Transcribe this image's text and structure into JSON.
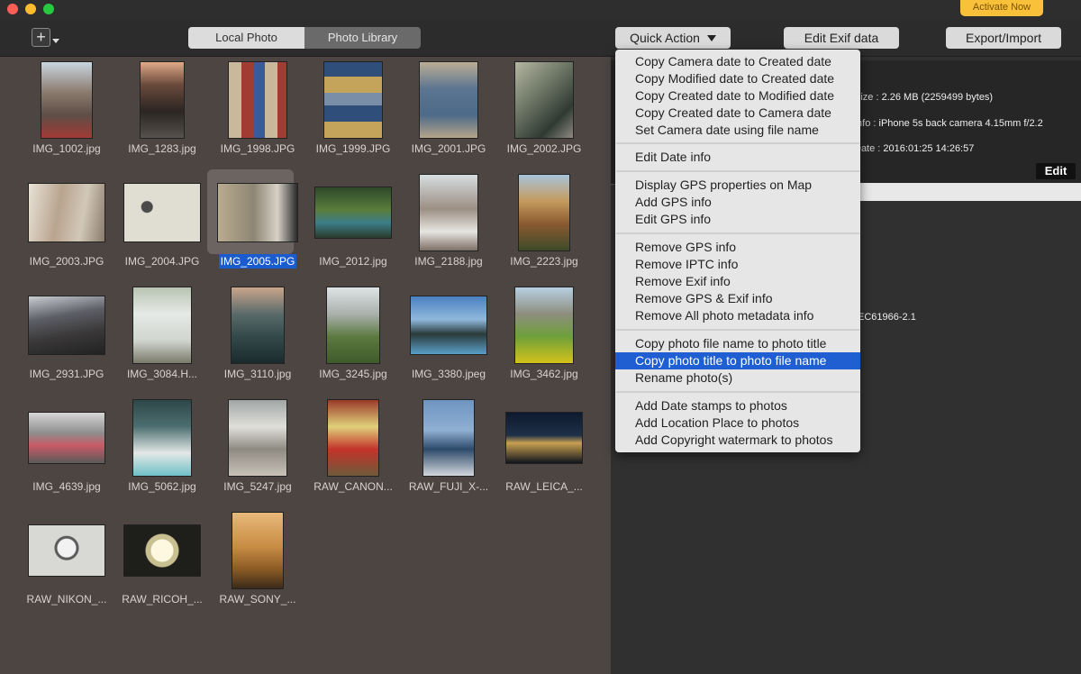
{
  "activate_label": "Activate Now",
  "toolbar": {
    "add_label": "+",
    "tabs": [
      "Local Photo",
      "Photo Library"
    ],
    "quick_action_label": "Quick Action",
    "edit_exif_label": "Edit Exif data",
    "export_label": "Export/Import"
  },
  "photos": [
    "IMG_1002.jpg",
    "IMG_1283.jpg",
    "IMG_1998.JPG",
    "IMG_1999.JPG",
    "IMG_2001.JPG",
    "IMG_2002.JPG",
    "IMG_2003.JPG",
    "IMG_2004.JPG",
    "IMG_2005.JPG",
    "IMG_2012.jpg",
    "IMG_2188.jpg",
    "IMG_2223.jpg",
    "IMG_2931.JPG",
    "IMG_3084.H...",
    "IMG_3110.jpg",
    "IMG_3245.jpg",
    "IMG_3380.jpeg",
    "IMG_3462.jpg",
    "IMG_4639.jpg",
    "IMG_5062.jpg",
    "IMG_5247.jpg",
    "RAW_CANON...",
    "RAW_FUJI_X-...",
    "RAW_LEICA_...",
    "RAW_NIKON_...",
    "RAW_RICOH_...",
    "RAW_SONY_..."
  ],
  "selected_photo": "IMG_2005.JPG",
  "info": {
    "size_key": "Size :",
    "size_value": "2.26 MB (2259499 bytes)",
    "info_key": "Info :",
    "info_value": "iPhone 5s back camera 4.15mm f/2.2",
    "date_key": "Date :",
    "date_value": "2016:01:25 14:26:57",
    "edit_label": "Edit",
    "color_profile": "EC61966-2.1"
  },
  "menu": {
    "groups": [
      [
        "Copy Camera date to Created date",
        "Copy Modified date to Created date",
        "Copy Created date to Modified date",
        "Copy Created date to Camera date",
        "Set Camera date using file name"
      ],
      [
        "Edit Date info"
      ],
      [
        "Display GPS properties on Map",
        "Add GPS info",
        "Edit GPS  info"
      ],
      [
        "Remove GPS info",
        "Remove IPTC info",
        "Remove Exif info",
        "Remove GPS & Exif info",
        "Remove All photo metadata info"
      ],
      [
        "Copy photo file name to photo title",
        "Copy photo title to photo file name",
        "Rename photo(s)"
      ],
      [
        "Add Date stamps to photos",
        "Add Location Place to photos",
        "Add Copyright watermark to photos"
      ]
    ],
    "highlighted": "Copy photo title to photo file name"
  }
}
